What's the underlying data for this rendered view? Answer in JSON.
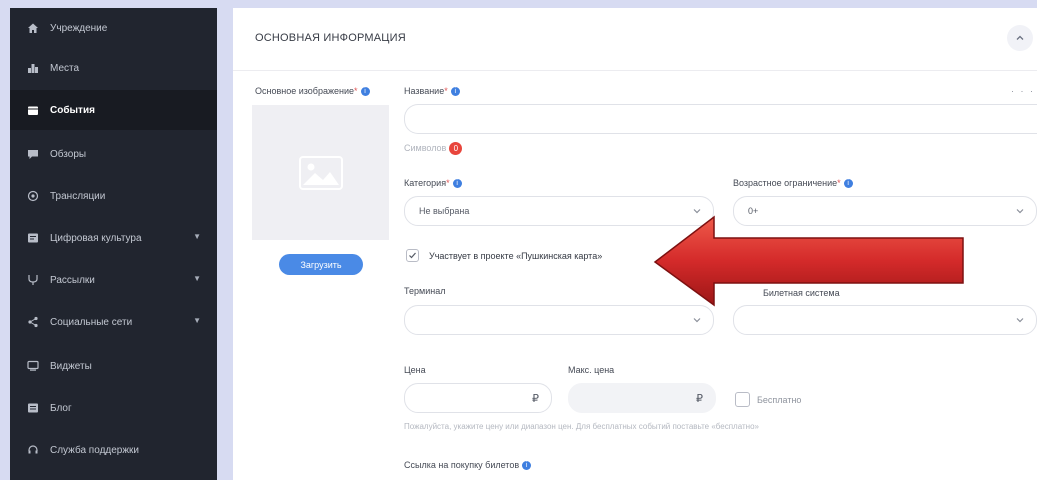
{
  "sidebar": {
    "items": [
      {
        "label": "Учреждение",
        "icon": "home-icon"
      },
      {
        "label": "Места",
        "icon": "places-icon"
      },
      {
        "label": "События",
        "icon": "events-icon",
        "active": true
      },
      {
        "label": "Обзоры",
        "icon": "reviews-icon"
      },
      {
        "label": "Трансляции",
        "icon": "broadcast-icon"
      },
      {
        "label": "Цифровая культура",
        "icon": "digital-culture-icon",
        "has_submenu": true
      },
      {
        "label": "Рассылки",
        "icon": "mailing-icon",
        "has_submenu": true
      },
      {
        "label": "Социальные сети",
        "icon": "share-icon",
        "has_submenu": true
      },
      {
        "label": "Виджеты",
        "icon": "widget-icon"
      },
      {
        "label": "Блог",
        "icon": "blog-icon"
      },
      {
        "label": "Служба поддержки",
        "icon": "support-icon"
      }
    ]
  },
  "main": {
    "header_title": "ОСНОВНАЯ ИНФОРМАЦИЯ",
    "image_label": "Основное изображение",
    "upload_label": "Загрузить",
    "name_label": "Название",
    "name_value": "",
    "symbols_label": "Символов",
    "symbols_count": "0",
    "category_label": "Категория",
    "category_value": "Не выбрана",
    "age_label": "Возрастное ограничение",
    "age_value": "0+",
    "pushkin_label": "Участвует в проекте «Пушкинская карта»",
    "terminal_label": "Терминал",
    "ticket_system_label": "Билетная система",
    "price_label": "Цена",
    "max_price_label": "Макс. цена",
    "currency": "₽",
    "free_label": "Бесплатно",
    "price_hint": "Пожалуйста, укажите цену или диапазон цен. Для бесплатных событий поставьте «бесплатно»",
    "ticket_link_label": "Ссылка на покупку билетов",
    "more_dots": "· · ·"
  },
  "colors": {
    "sidebar_bg": "#21252f",
    "accent": "#4a8ae6",
    "arrow": "#d42a2a",
    "page_bg": "#d7dbf2"
  }
}
